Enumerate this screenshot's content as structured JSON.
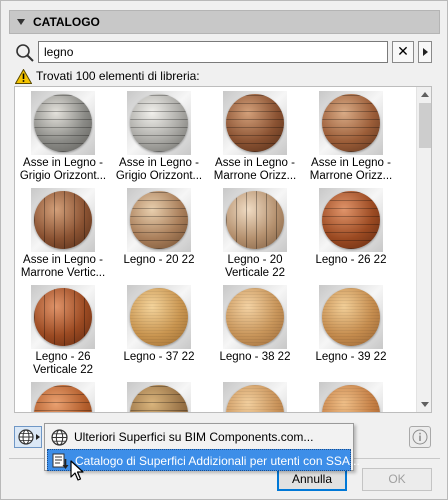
{
  "section": {
    "title": "CATALOGO"
  },
  "search": {
    "value": "legno",
    "clear_label": "✕"
  },
  "status": {
    "text": "Trovati 100 elementi di libreria:"
  },
  "items": [
    {
      "line1": "Asse in Legno -",
      "line2": "Grigio Orizzont...",
      "c1": "#8a8a86",
      "c2": "#e4e2dc",
      "c3": "#5b5a56",
      "stripe": "h"
    },
    {
      "line1": "Asse in Legno -",
      "line2": "Grigio Orizzont...",
      "c1": "#a9a8a4",
      "c2": "#f1f0ec",
      "c3": "#6a6a66",
      "stripe": "h"
    },
    {
      "line1": "Asse in Legno -",
      "line2": "Marrone Orizz...",
      "c1": "#8a5232",
      "c2": "#d3a07a",
      "c3": "#4f2a16",
      "stripe": "h"
    },
    {
      "line1": "Asse in Legno -",
      "line2": "Marrone Orizz...",
      "c1": "#9b5d38",
      "c2": "#d9ab86",
      "c3": "#5a311b",
      "stripe": "h"
    },
    {
      "line1": "Asse in Legno -",
      "line2": "Marrone Vertic...",
      "c1": "#8a5232",
      "c2": "#d3a07a",
      "c3": "#4f2a16",
      "stripe": "v"
    },
    {
      "line1": "Legno - 20 22",
      "line2": "",
      "c1": "#a97e5a",
      "c2": "#e8cfae",
      "c3": "#6b4a2e",
      "stripe": "h"
    },
    {
      "line1": "Legno - 20",
      "line2": "Verticale 22",
      "c1": "#b4906e",
      "c2": "#f0dcc4",
      "c3": "#7a5a3e",
      "stripe": "v"
    },
    {
      "line1": "Legno - 26 22",
      "line2": "",
      "c1": "#9b4a22",
      "c2": "#e0946a",
      "c3": "#5e2810",
      "stripe": "h"
    },
    {
      "line1": "Legno - 26",
      "line2": "Verticale 22",
      "c1": "#9b4a22",
      "c2": "#e0946a",
      "c3": "#5e2810",
      "stripe": "v"
    },
    {
      "line1": "Legno - 37 22",
      "line2": "",
      "c1": "#c99550",
      "c2": "#f4d49c",
      "c3": "#9a6a30",
      "stripe": "f"
    },
    {
      "line1": "Legno - 38 22",
      "line2": "",
      "c1": "#c8955a",
      "c2": "#f4d3a4",
      "c3": "#9a6838",
      "stripe": "f"
    },
    {
      "line1": "Legno - 39 22",
      "line2": "",
      "c1": "#c58c4e",
      "c2": "#f2cf98",
      "c3": "#966232",
      "stripe": "f"
    },
    {
      "line1": "",
      "line2": "",
      "c1": "#b35e2c",
      "c2": "#e9a070",
      "c3": "#7a3a18",
      "stripe": "h"
    },
    {
      "line1": "",
      "line2": "",
      "c1": "#9a7448",
      "c2": "#d9b47c",
      "c3": "#6a4a28",
      "stripe": "h"
    },
    {
      "line1": "",
      "line2": "",
      "c1": "#c9935a",
      "c2": "#f2cf9e",
      "c3": "#9a6838",
      "stripe": "f"
    },
    {
      "line1": "",
      "line2": "",
      "c1": "#c47e44",
      "c2": "#efbf88",
      "c3": "#93562a",
      "stripe": "f"
    }
  ],
  "menu": {
    "item1": "Ulteriori Superfici su BIM Components.com...",
    "item2": "Catalogo di Superfici Addizionali per utenti con SSA..."
  },
  "buttons": {
    "cancel": "Annulla",
    "ok": "OK"
  },
  "icons": {
    "search": "magnifier-icon",
    "warning": "warning-icon",
    "globe": "globe-icon",
    "download": "download-icon",
    "info": "info-icon",
    "cursor": "mouse-cursor-icon"
  }
}
